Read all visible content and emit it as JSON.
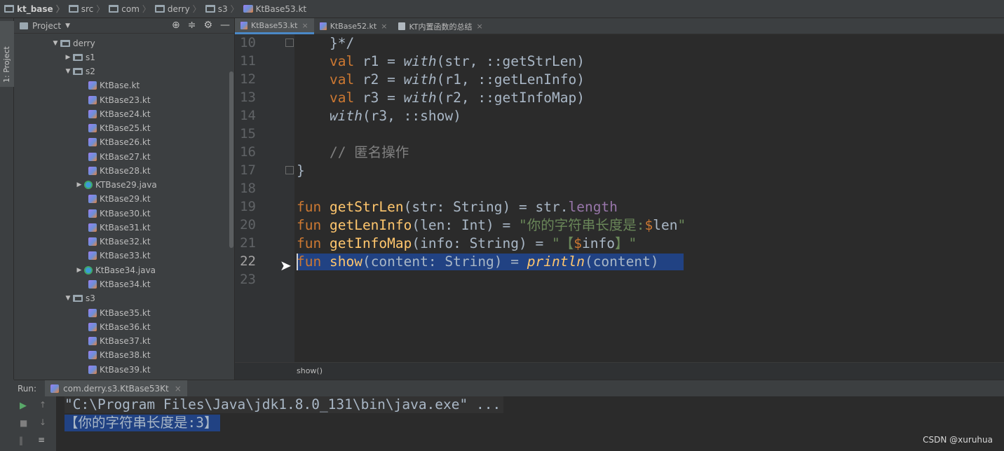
{
  "breadcrumb": {
    "items": [
      {
        "label": "kt_base",
        "icon": "module-folder-icon"
      },
      {
        "label": "src",
        "icon": "folder-icon"
      },
      {
        "label": "com",
        "icon": "folder-icon"
      },
      {
        "label": "derry",
        "icon": "folder-icon"
      },
      {
        "label": "s3",
        "icon": "folder-icon"
      },
      {
        "label": "KtBase53.kt",
        "icon": "kotlin-file-icon"
      }
    ]
  },
  "sidebar_strip": {
    "label": "1: Project"
  },
  "project_panel": {
    "title": "Project",
    "tools": [
      "target-icon",
      "collapse-icon",
      "gear-icon",
      "minimize-icon"
    ],
    "tree": [
      {
        "label": "derry",
        "type": "folder",
        "expanded": true,
        "depth": 0
      },
      {
        "label": "s1",
        "type": "folder",
        "expanded": false,
        "depth": 1
      },
      {
        "label": "s2",
        "type": "folder",
        "expanded": true,
        "depth": 1
      },
      {
        "label": "KtBase.kt",
        "type": "kt",
        "depth": 2
      },
      {
        "label": "KtBase23.kt",
        "type": "kt",
        "depth": 2
      },
      {
        "label": "KtBase24.kt",
        "type": "kt",
        "depth": 2
      },
      {
        "label": "KtBase25.kt",
        "type": "kt",
        "depth": 2
      },
      {
        "label": "KtBase26.kt",
        "type": "kt",
        "depth": 2
      },
      {
        "label": "KtBase27.kt",
        "type": "kt",
        "depth": 2
      },
      {
        "label": "KtBase28.kt",
        "type": "kt",
        "depth": 2
      },
      {
        "label": "KTBase29.java",
        "type": "java",
        "expanded": false,
        "depth": 2
      },
      {
        "label": "KtBase29.kt",
        "type": "kt",
        "depth": 2
      },
      {
        "label": "KtBase30.kt",
        "type": "kt",
        "depth": 2
      },
      {
        "label": "KtBase31.kt",
        "type": "kt",
        "depth": 2
      },
      {
        "label": "KtBase32.kt",
        "type": "kt",
        "depth": 2
      },
      {
        "label": "KtBase33.kt",
        "type": "kt",
        "depth": 2
      },
      {
        "label": "KtBase34.java",
        "type": "java",
        "expanded": false,
        "depth": 2
      },
      {
        "label": "KtBase34.kt",
        "type": "kt",
        "depth": 2
      },
      {
        "label": "s3",
        "type": "folder",
        "expanded": true,
        "depth": 1
      },
      {
        "label": "KtBase35.kt",
        "type": "kt",
        "depth": 2
      },
      {
        "label": "KtBase36.kt",
        "type": "kt",
        "depth": 2
      },
      {
        "label": "KtBase37.kt",
        "type": "kt",
        "depth": 2
      },
      {
        "label": "KtBase38.kt",
        "type": "kt",
        "depth": 2
      },
      {
        "label": "KtBase39.kt",
        "type": "kt",
        "depth": 2
      }
    ]
  },
  "tabs": [
    {
      "label": "KtBase53.kt",
      "active": true,
      "icon": "kotlin-file-icon"
    },
    {
      "label": "KtBase52.kt",
      "active": false,
      "icon": "kotlin-file-icon"
    },
    {
      "label": "KT内置函数的总结",
      "active": false,
      "icon": "text-file-icon"
    }
  ],
  "editor": {
    "line_numbers": [
      "10",
      "11",
      "12",
      "13",
      "14",
      "15",
      "16",
      "17",
      "18",
      "19",
      "20",
      "21",
      "22",
      "23"
    ],
    "current_line": "22",
    "code": {
      "l10": "    }*/",
      "l11_kw": "val",
      "l11_rest": " r1 = ",
      "l11_with": "with",
      "l11_tail": "(str, ::getStrLen)",
      "l12_kw": "val",
      "l12_rest": " r2 = ",
      "l12_with": "with",
      "l12_tail": "(r1, ::getLenInfo)",
      "l13_kw": "val",
      "l13_rest": " r3 = ",
      "l13_with": "with",
      "l13_tail": "(r2, ::getInfoMap)",
      "l14_with": "with",
      "l14_tail": "(r3, ::show)",
      "l16_comment": "// 匿名操作",
      "l17": "}",
      "l19_kw": "fun",
      "l19_fn": "getStrLen",
      "l19_rest": "(str: String) = str.",
      "l19_prop": "length",
      "l20_kw": "fun",
      "l20_fn": "getLenInfo",
      "l20_rest": "(len: Int) = ",
      "l20_str": "\"你的字符串长度是:",
      "l20_tmpl": "$",
      "l20_var": "len",
      "l20_end": "\"",
      "l21_kw": "fun",
      "l21_fn": "getInfoMap",
      "l21_rest": "(info: String) = ",
      "l21_str": "\"【",
      "l21_tmpl": "$",
      "l21_var": "info",
      "l21_end": "】\"",
      "l22_kw": "fun",
      "l22_fn": "show",
      "l22_rest": "(content: String) = ",
      "l22_call": "println",
      "l22_tail": "(content)"
    },
    "breadcrumb_hint": "show()"
  },
  "run_panel": {
    "label": "Run:",
    "config": "com.derry.s3.KtBase53Kt",
    "output": [
      "\"C:\\Program Files\\Java\\jdk1.8.0_131\\bin\\java.exe\" ...",
      "【你的字符串长度是:3】"
    ]
  },
  "watermark": "CSDN @xuruhua",
  "colors": {
    "keyword": "#cc7832",
    "function": "#ffc66d",
    "string": "#6a8759",
    "comment": "#808080",
    "selection": "#214283"
  }
}
